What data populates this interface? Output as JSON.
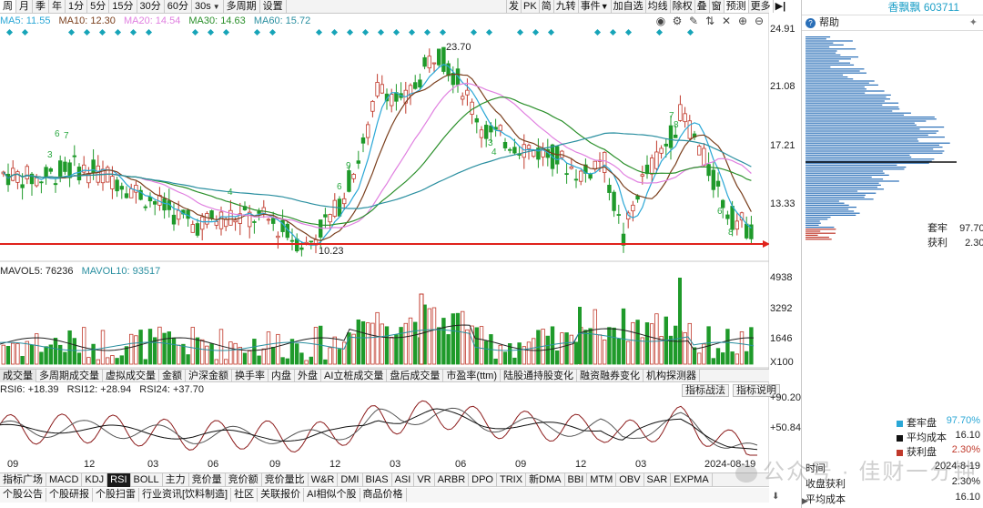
{
  "top_periods": [
    {
      "label": "周",
      "active": true
    },
    {
      "label": "月",
      "active": false
    },
    {
      "label": "季",
      "active": false
    },
    {
      "label": "年",
      "active": false
    },
    {
      "label": "1分",
      "active": false
    },
    {
      "label": "5分",
      "active": false
    },
    {
      "label": "15分",
      "active": false
    },
    {
      "label": "30分",
      "active": false
    },
    {
      "label": "60分",
      "active": false
    },
    {
      "label": "30s",
      "active": false,
      "dropdown": true
    },
    {
      "label": "多周期",
      "active": false
    },
    {
      "label": "设置",
      "active": false
    }
  ],
  "tool_buttons": [
    "发",
    "PK",
    "简",
    "九转",
    "事件",
    "加自选",
    "均线",
    "除权",
    "叠",
    "窗",
    "预测",
    "更多"
  ],
  "ma_legend": [
    {
      "label": "MA5: 11.55",
      "color": "#2aa7d6"
    },
    {
      "label": "MA10: 12.30",
      "color": "#7a3f1d"
    },
    {
      "label": "MA20: 14.54",
      "color": "#e080e0"
    },
    {
      "label": "MA30: 14.63",
      "color": "#2a8f2a"
    },
    {
      "label": "MA60: 15.72",
      "color": "#2a8fa0"
    }
  ],
  "price_axis": [
    "24.91",
    "21.08",
    "17.21",
    "13.33"
  ],
  "price_annotations": {
    "high": "23.70",
    "low": "10.23"
  },
  "vol_legend": [
    {
      "label": "MAVOL5: 76236",
      "color": "#222"
    },
    {
      "label": "MAVOL10: 93517",
      "color": "#2a8fa0"
    }
  ],
  "vol_axis": [
    "4938",
    "3292",
    "1646",
    "X100"
  ],
  "indicator_tabs": [
    "成交量",
    "多周期成交量",
    "虚拟成交量",
    "金额",
    "沪深金额",
    "换手率",
    "内盘",
    "外盘",
    "AI立桩成交量",
    "盘后成交量",
    "市盈率(ttm)",
    "陆股通持股变化",
    "融资融券变化",
    "机构探测器"
  ],
  "rsi_legend": [
    {
      "label": "RSI6: +18.39",
      "color": "#222"
    },
    {
      "label": "RSI12: +28.94",
      "color": "#222"
    },
    {
      "label": "RSI24: +37.70",
      "color": "#222"
    }
  ],
  "rsi_buttons": [
    "指标战法",
    "指标说明"
  ],
  "rsi_axis": [
    "+90.20",
    "+50.84"
  ],
  "date_axis": [
    "09",
    "12",
    "03",
    "06",
    "09",
    "12",
    "03",
    "06",
    "09",
    "12",
    "03",
    "2024-08-19"
  ],
  "bottom_indicators": [
    "指标广场",
    "MACD",
    "KDJ",
    "RSI",
    "BOLL",
    "主力",
    "竞价量",
    "竞价额",
    "竞价量比",
    "W&R",
    "DMI",
    "BIAS",
    "ASI",
    "VR",
    "ARBR",
    "DPO",
    "TRIX",
    "新DMA",
    "BBI",
    "MTM",
    "OBV",
    "SAR",
    "EXPMA"
  ],
  "active_indicator": "RSI",
  "news_tabs": [
    "个股公告",
    "个股研报",
    "个股扫雷",
    "行业资讯[饮料制造]",
    "社区",
    "关联报价",
    "AI相似个股",
    "商品价格"
  ],
  "right_panel": {
    "title": "香飘飘 603711",
    "help_label": "帮助",
    "cost_summary": [
      {
        "label": "套牢",
        "value": "97.70%"
      },
      {
        "label": "获利",
        "value": "2.30%"
      }
    ],
    "legend": [
      {
        "label": "套牢盘",
        "value": "97.70%",
        "color": "#2aa7d6"
      },
      {
        "label": "平均成本",
        "value": "16.10",
        "color": "#111111"
      },
      {
        "label": "获利盘",
        "value": "2.30%",
        "color": "#c0392b"
      }
    ],
    "info_rows": [
      {
        "label": "时间",
        "value": "2024-8-19"
      },
      {
        "label": "收盘获利",
        "value": "2.30%"
      },
      {
        "label": "平均成本",
        "value": "16.10"
      }
    ]
  },
  "watermark": "公众号 · 佳财一分钟",
  "colors": {
    "up": "#c0392b",
    "down": "#1f9a2a",
    "support_line": "#e0231c",
    "signal": "#17a4b8"
  }
}
